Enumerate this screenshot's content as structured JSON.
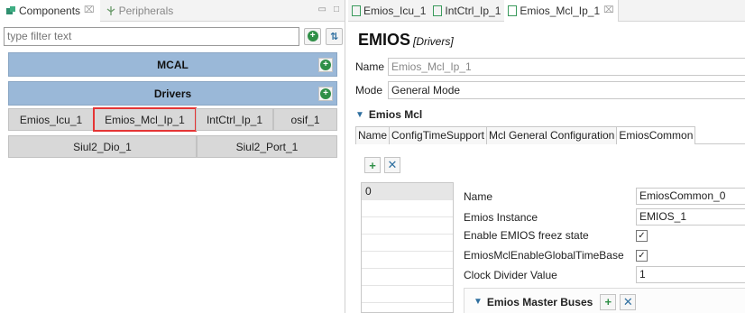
{
  "left_panel": {
    "tabs": [
      {
        "label": "Components",
        "close": "⌧"
      },
      {
        "label": "Peripherals"
      }
    ],
    "filter_placeholder": "type filter text",
    "mcal_label": "MCAL",
    "drivers_label": "Drivers",
    "row1": [
      "Emios_Icu_1",
      "Emios_Mcl_Ip_1",
      "IntCtrl_Ip_1",
      "osif_1"
    ],
    "row2": [
      "Siul2_Dio_1",
      "Siul2_Port_1"
    ]
  },
  "right_panel": {
    "tabs": [
      "Emios_Icu_1",
      "IntCtrl_Ip_1",
      "Emios_Mcl_Ip_1"
    ],
    "title": "EMIOS",
    "title_sub": "[Drivers]",
    "name_label": "Name",
    "name_value": "Emios_Mcl_Ip_1",
    "mode_label": "Mode",
    "mode_value": "General Mode",
    "section_label": "Emios Mcl",
    "subtabs": [
      "Name",
      "ConfigTimeSupport",
      "Mcl General Configuration",
      "EmiosCommon"
    ],
    "list_items": [
      "0"
    ],
    "props": [
      {
        "label": "Name",
        "value": "EmiosCommon_0"
      },
      {
        "label": "Emios Instance",
        "value": "EMIOS_1"
      },
      {
        "label": "Enable EMIOS freez state",
        "check": "✓"
      },
      {
        "label": "EmiosMclEnableGlobalTimeBase",
        "check": "✓"
      },
      {
        "label": "Clock Divider Value",
        "value": "1"
      }
    ],
    "subsection_label": "Emios Master Buses"
  },
  "icons": [
    "components-icon",
    "peripherals-icon",
    "add-icon",
    "sort-icon",
    "remove-icon",
    "chevron-down-icon",
    "file-icon"
  ],
  "colors": {
    "bar_blue": "#9ab8d8",
    "selection_red": "#e53535",
    "add_green": "#2f8f47"
  }
}
